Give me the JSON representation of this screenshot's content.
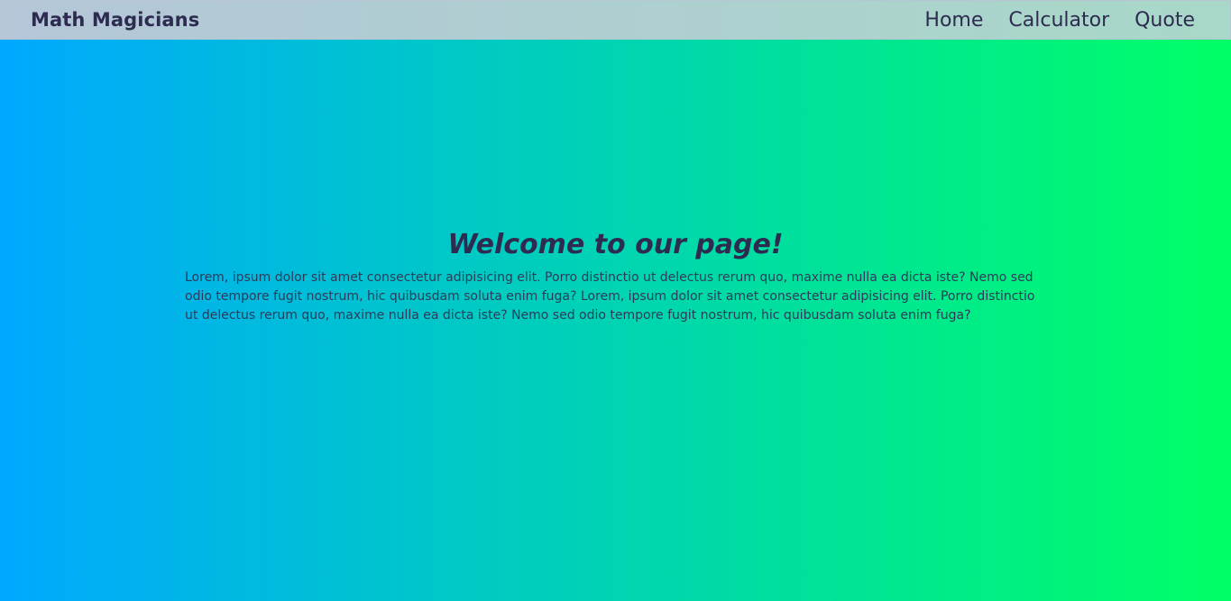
{
  "navbar": {
    "brand": "Math Magicians",
    "links": [
      {
        "label": "Home"
      },
      {
        "label": "Calculator"
      },
      {
        "label": "Quote"
      }
    ]
  },
  "main": {
    "title": "Welcome to our page!",
    "paragraph": "Lorem, ipsum dolor sit amet consectetur adipisicing elit. Porro distinctio ut delectus rerum quo, maxime nulla ea dicta iste? Nemo sed odio tempore fugit nostrum, hic quibusdam soluta enim fuga? Lorem, ipsum dolor sit amet consectetur adipisicing elit. Porro distinctio ut delectus rerum quo, maxime nulla ea dicta iste? Nemo sed odio tempore fugit nostrum, hic quibusdam soluta enim fuga?"
  },
  "colors": {
    "gradient_start": "#00a8ff",
    "gradient_end": "#00ff66",
    "text": "#2d2b50"
  }
}
